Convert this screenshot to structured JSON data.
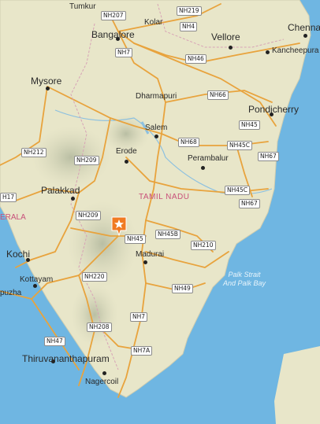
{
  "map": {
    "region_label": "TAMIL NADU",
    "cities": [
      {
        "name": "Tumkur",
        "key": "tumkur"
      },
      {
        "name": "Kolar",
        "key": "kolar"
      },
      {
        "name": "Bangalore",
        "key": "bangalore"
      },
      {
        "name": "Vellore",
        "key": "vellore"
      },
      {
        "name": "Chenna",
        "key": "chennai"
      },
      {
        "name": "Kancheepura",
        "key": "kancheepuram"
      },
      {
        "name": "Mysore",
        "key": "mysore"
      },
      {
        "name": "Dharmapuri",
        "key": "dharmapuri"
      },
      {
        "name": "Pondicherry",
        "key": "pondicherry"
      },
      {
        "name": "Salem",
        "key": "salem"
      },
      {
        "name": "Erode",
        "key": "erode"
      },
      {
        "name": "Perambalur",
        "key": "perambalur"
      },
      {
        "name": "Palakkad",
        "key": "palakkad"
      },
      {
        "name": "ERALA",
        "key": "kerala"
      },
      {
        "name": "Kochi",
        "key": "kochi"
      },
      {
        "name": "Madurai",
        "key": "madurai"
      },
      {
        "name": "Kottayam",
        "key": "kottayam"
      },
      {
        "name": "puzha",
        "key": "alappuzha"
      },
      {
        "name": "Thiruvananthapuram",
        "key": "thiruvananthapuram"
      },
      {
        "name": "Nagercoil",
        "key": "nagercoil"
      }
    ],
    "sea_label": [
      "Palk Strait",
      "And Palk Bay"
    ],
    "highways": [
      "NH207",
      "NH219",
      "NH4",
      "NH7",
      "NH46",
      "NH66",
      "NH45",
      "NH68",
      "NH45C",
      "NH67",
      "NH212",
      "NH209",
      "H17",
      "NH45C",
      "NH67",
      "NH209",
      "NH45",
      "NH45B",
      "NH210",
      "NH220",
      "NH49",
      "NH7",
      "NH208",
      "NH47",
      "NH7A"
    ],
    "marker_icon": "star-pin-icon"
  },
  "colors": {
    "land": "#e8e6c9",
    "water": "#6fb6e2",
    "road": "#e8a33d",
    "marker": "#f07a22"
  }
}
